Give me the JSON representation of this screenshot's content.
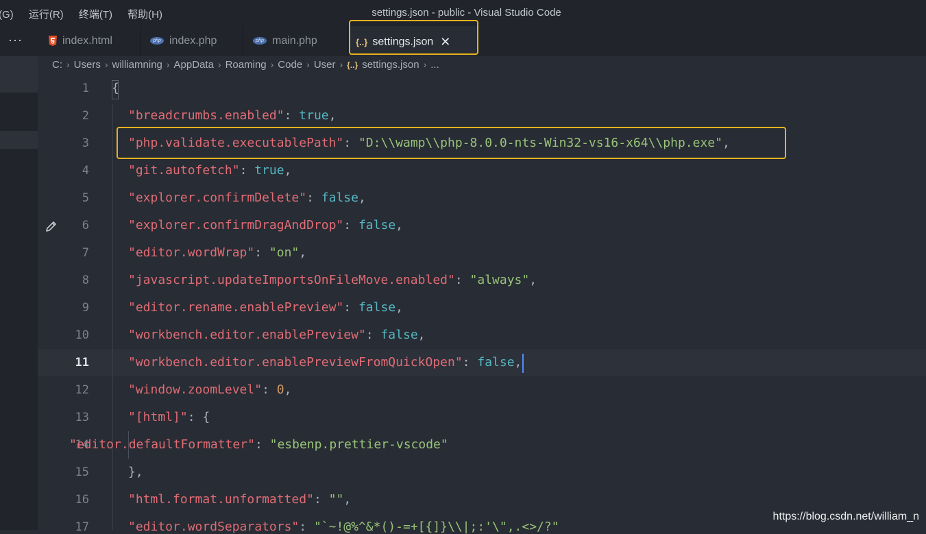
{
  "menu": {
    "items": [
      "(G)",
      "运行(R)",
      "终端(T)",
      "帮助(H)"
    ]
  },
  "window": {
    "title": "settings.json - public - Visual Studio Code"
  },
  "tabs": {
    "overflow_label": "···",
    "items": [
      {
        "label": "index.html",
        "icon": "html5-icon"
      },
      {
        "label": "index.php",
        "icon": "php-icon"
      },
      {
        "label": "main.php",
        "icon": "php-icon"
      },
      {
        "label": "settings.json",
        "icon": "json-icon",
        "active": true
      }
    ],
    "json_icon_glyph": "{..}",
    "php_icon_text": "php",
    "close_glyph": "✕"
  },
  "breadcrumb": {
    "segments": [
      "C:",
      "Users",
      "williamning",
      "AppData",
      "Roaming",
      "Code",
      "User",
      "settings.json",
      "..."
    ],
    "separator": "›"
  },
  "editor": {
    "current_line": 11,
    "line_numbers": [
      "1",
      "2",
      "3",
      "4",
      "5",
      "6",
      "7",
      "8",
      "9",
      "10",
      "11",
      "12",
      "13",
      "14",
      "15",
      "16",
      "17"
    ],
    "lines": [
      {
        "key": "",
        "punct": "{"
      },
      {
        "key": "\"breadcrumbs.enabled\"",
        "value": "true",
        "value_type": "bool"
      },
      {
        "key": "\"php.validate.executablePath\"",
        "value": "\"D:\\\\wamp\\\\php-8.0.0-nts-Win32-vs16-x64\\\\php.exe\"",
        "value_type": "string"
      },
      {
        "key": "\"git.autofetch\"",
        "value": "true",
        "value_type": "bool"
      },
      {
        "key": "\"explorer.confirmDelete\"",
        "value": "false",
        "value_type": "bool"
      },
      {
        "key": "\"explorer.confirmDragAndDrop\"",
        "value": "false",
        "value_type": "bool"
      },
      {
        "key": "\"editor.wordWrap\"",
        "value": "\"on\"",
        "value_type": "string"
      },
      {
        "key": "\"javascript.updateImportsOnFileMove.enabled\"",
        "value": "\"always\"",
        "value_type": "string"
      },
      {
        "key": "\"editor.rename.enablePreview\"",
        "value": "false",
        "value_type": "bool"
      },
      {
        "key": "\"workbench.editor.enablePreview\"",
        "value": "false",
        "value_type": "bool"
      },
      {
        "key": "\"workbench.editor.enablePreviewFromQuickOpen\"",
        "value": "false",
        "value_type": "bool"
      },
      {
        "key": "\"window.zoomLevel\"",
        "value": "0",
        "value_type": "number"
      },
      {
        "key": "\"[html]\"",
        "value": "{",
        "value_type": "punct"
      },
      {
        "key": "\"editor.defaultFormatter\"",
        "value": "\"esbenp.prettier-vscode\"",
        "value_type": "string"
      },
      {
        "key": "",
        "punct": "},"
      },
      {
        "key": "\"html.format.unformatted\"",
        "value": "\"\"",
        "value_type": "string"
      },
      {
        "key": "\"editor.wordSeparators\"",
        "value": "\"`~!@%^&*()-=+[{]}\\\\|;:'\\\",.<>/?\"",
        "value_type": "string"
      }
    ],
    "colon": ": ",
    "comma": ","
  },
  "colors": {
    "accent_highlight": "#e8b21c",
    "key": "#e06c75",
    "string": "#98c379",
    "boolean": "#56b6c2",
    "number": "#d19a66",
    "background": "#282c34"
  },
  "watermark": "https://blog.csdn.net/william_n"
}
